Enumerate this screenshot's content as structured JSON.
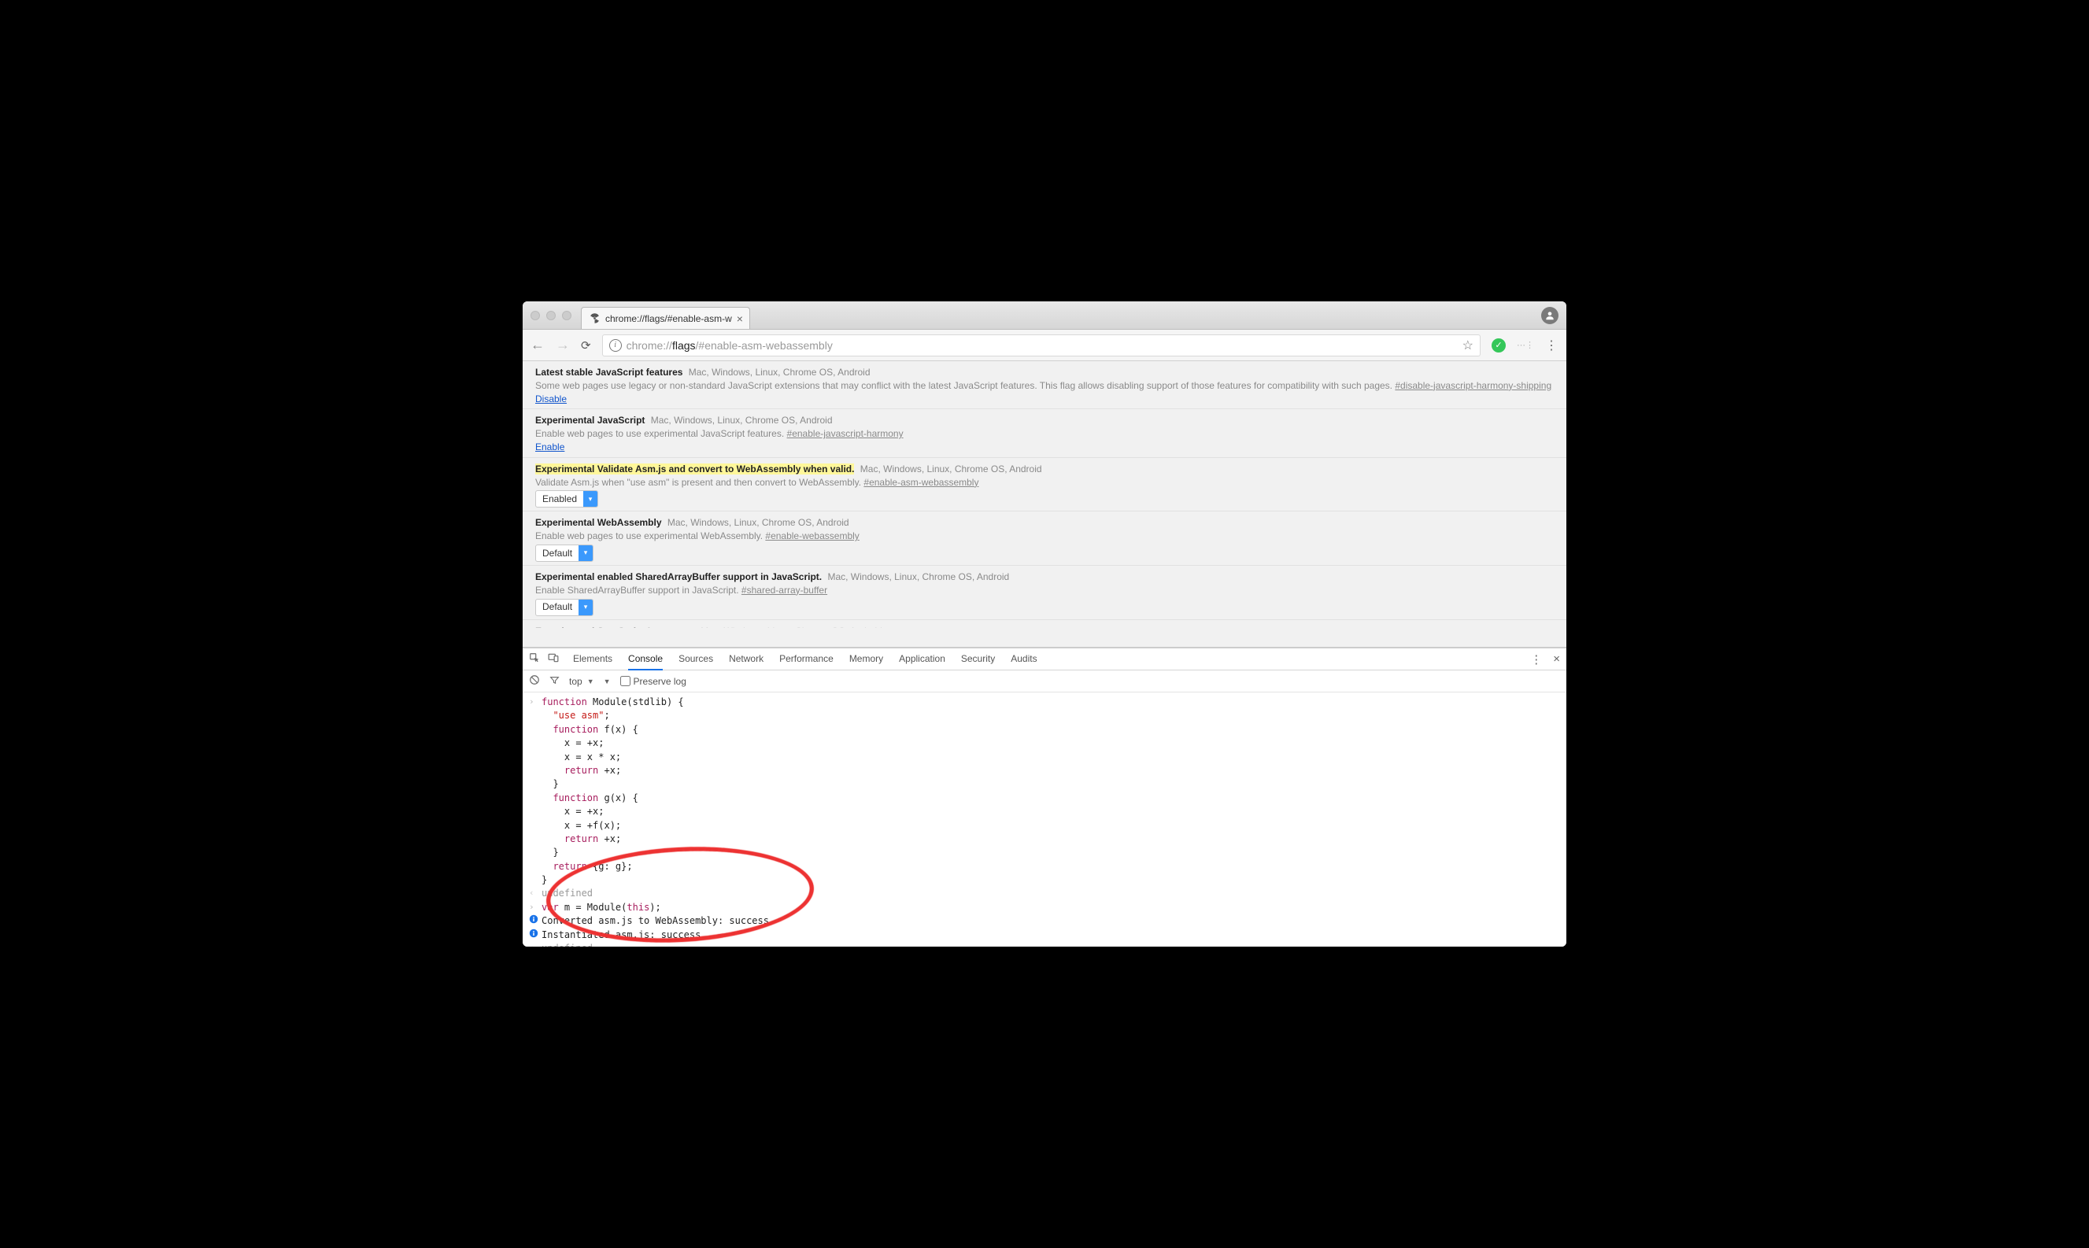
{
  "tab": {
    "title": "chrome://flags/#enable-asm-w"
  },
  "url": {
    "scheme": "chrome://",
    "host": "flags",
    "path": "/#enable-asm-webassembly"
  },
  "flags": [
    {
      "title": "Latest stable JavaScript features",
      "platforms": "Mac, Windows, Linux, Chrome OS, Android",
      "description": "Some web pages use legacy or non-standard JavaScript extensions that may conflict with the latest JavaScript features. This flag allows disabling support of those features for compatibility with such pages.",
      "hash": "#disable-javascript-harmony-shipping",
      "action_type": "link",
      "action_label": "Disable",
      "highlight": false
    },
    {
      "title": "Experimental JavaScript",
      "platforms": "Mac, Windows, Linux, Chrome OS, Android",
      "description": "Enable web pages to use experimental JavaScript features.",
      "hash": "#enable-javascript-harmony",
      "action_type": "link",
      "action_label": "Enable",
      "highlight": false
    },
    {
      "title": "Experimental Validate Asm.js and convert to WebAssembly when valid.",
      "platforms": "Mac, Windows, Linux, Chrome OS, Android",
      "description": "Validate Asm.js when \"use asm\" is present and then convert to WebAssembly.",
      "hash": "#enable-asm-webassembly",
      "action_type": "select",
      "action_label": "Enabled",
      "highlight": true
    },
    {
      "title": "Experimental WebAssembly",
      "platforms": "Mac, Windows, Linux, Chrome OS, Android",
      "description": "Enable web pages to use experimental WebAssembly.",
      "hash": "#enable-webassembly",
      "action_type": "select",
      "action_label": "Default",
      "highlight": false
    },
    {
      "title": "Experimental enabled SharedArrayBuffer support in JavaScript.",
      "platforms": "Mac, Windows, Linux, Chrome OS, Android",
      "description": "Enable SharedArrayBuffer support in JavaScript.",
      "hash": "#shared-array-buffer",
      "action_type": "select",
      "action_label": "Default",
      "highlight": false
    }
  ],
  "devtools": {
    "tabs": [
      "Elements",
      "Console",
      "Sources",
      "Network",
      "Performance",
      "Memory",
      "Application",
      "Security",
      "Audits"
    ],
    "active_tab": "Console",
    "context": "top",
    "preserve_log_label": "Preserve log",
    "preserve_log_checked": false
  },
  "console": {
    "lines": [
      {
        "g": "in",
        "html": "<span class='kw'>function</span> Module(stdlib) {"
      },
      {
        "g": "",
        "html": "  <span class='str'>\"use asm\"</span>;"
      },
      {
        "g": "",
        "html": "  <span class='kw'>function</span> f(x) {"
      },
      {
        "g": "",
        "html": "    x = +x;"
      },
      {
        "g": "",
        "html": "    x = x * x;"
      },
      {
        "g": "",
        "html": "    <span class='kw'>return</span> +x;"
      },
      {
        "g": "",
        "html": "  }"
      },
      {
        "g": "",
        "html": "  <span class='kw'>function</span> g(x) {"
      },
      {
        "g": "",
        "html": "    x = +x;"
      },
      {
        "g": "",
        "html": "    x = +f(x);"
      },
      {
        "g": "",
        "html": "    <span class='kw'>return</span> +x;"
      },
      {
        "g": "",
        "html": "  }"
      },
      {
        "g": "",
        "html": "  <span class='kw'>return</span> {g: g};"
      },
      {
        "g": "",
        "html": "}"
      },
      {
        "g": "out",
        "html": "<span class='undef'>undefined</span>"
      },
      {
        "g": "in",
        "html": "<span class='kw'>var</span> m = Module(<span class='kw'>this</span>);"
      },
      {
        "g": "info",
        "html": "Converted asm.js to WebAssembly: success"
      },
      {
        "g": "info",
        "html": "Instantiated asm.js: success"
      },
      {
        "g": "out",
        "html": "<span class='undef'>undefined</span>"
      }
    ]
  }
}
